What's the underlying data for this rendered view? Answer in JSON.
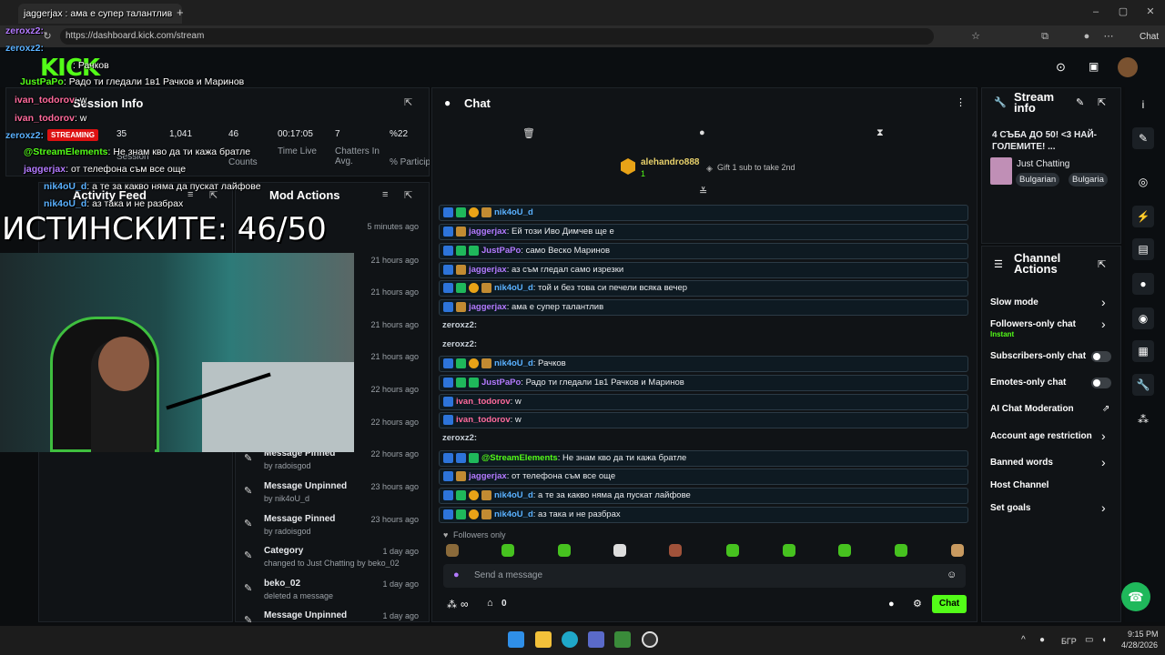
{
  "browser": {
    "tab_title": "jaggerjax : ама е супер талантлив",
    "url": "https://dashboard.kick.com/stream",
    "chat_btn": "Chat",
    "window_controls": [
      "–",
      "▢",
      "✕"
    ]
  },
  "overlay_chat": [
    {
      "user": "zeroxz2:",
      "text": ""
    },
    {
      "user": "zeroxz2:",
      "text": ""
    },
    {
      "user": "",
      "text": ": Рачков"
    },
    {
      "user": "JustPaPo",
      "text": ": Радо ти гледали 1в1 Рачков и Маринов"
    },
    {
      "user": "ivan_todorov",
      "text": ": w"
    },
    {
      "user": "ivan_todorov",
      "text": ": w"
    },
    {
      "user": "zeroxz2:",
      "text": ""
    },
    {
      "user": "@StreamElements",
      "text": ": Не знам кво да ти кажа братле"
    },
    {
      "user": "jaggerjax",
      "text": ": от телефона съм все още"
    },
    {
      "user": "nik4oU_d",
      "text": ": а те за какво няма да пускат лайфове"
    },
    {
      "user": "nik4oU_d",
      "text": ": аз така и не разбрах"
    }
  ],
  "big_overlay": "ИСТИНСКИТЕ: 46/50",
  "session": {
    "title": "Session Info",
    "streaming": "STREAMING",
    "stats": [
      {
        "value": "35",
        "label": "Session"
      },
      {
        "value": "1,041",
        "label": ""
      },
      {
        "value": "46",
        "label": "Counts"
      },
      {
        "value": "00:17:05",
        "label": "Time Live"
      },
      {
        "value": "7",
        "label": "Chatters In Avg."
      },
      {
        "value": "%22",
        "label": "% Participat"
      }
    ]
  },
  "activity": {
    "title": "Activity Feed"
  },
  "mod": {
    "title": "Mod Actions",
    "rows": [
      {
        "title": "",
        "sub": "",
        "time": "5 minutes ago"
      },
      {
        "title": "",
        "sub": "",
        "time": "21 hours ago"
      },
      {
        "title": "",
        "sub": "",
        "time": "21 hours ago"
      },
      {
        "title": "",
        "sub": "",
        "time": "21 hours ago"
      },
      {
        "title": "",
        "sub": "by beko_02",
        "time": "21 hours ago"
      },
      {
        "title": "",
        "sub": "beko_02",
        "time": "22 hours ago"
      },
      {
        "title": "",
        "sub": "",
        "time": "22 hours ago"
      },
      {
        "title": "Message Pinned",
        "sub": "by radoisgod",
        "time": "22 hours ago"
      },
      {
        "title": "Message Unpinned",
        "sub": "by nik4oU_d",
        "time": "23 hours ago"
      },
      {
        "title": "Message Pinned",
        "sub": "by radoisgod",
        "time": "23 hours ago"
      },
      {
        "title": "Category",
        "sub": "changed to Just Chatting by beko_02",
        "time": "1 day ago"
      },
      {
        "title": "beko_02",
        "sub": "deleted a message",
        "time": "1 day ago"
      },
      {
        "title": "Message Unpinned",
        "sub": "",
        "time": "1 day ago"
      }
    ]
  },
  "chat": {
    "title": "Chat",
    "pinned_user": "alehandro888",
    "pinned_count": "1",
    "gift_text": "Gift 1 sub to take 2nd",
    "messages": [
      {
        "user": "nik4oU_d",
        "color": "blue",
        "text": "",
        "badges": [
          "blue",
          "green",
          "gold",
          "gift"
        ]
      },
      {
        "user": "jaggerjax",
        "color": "purple",
        "text": ": Ей този Иво Димчев ще е",
        "badges": [
          "blue",
          "gift"
        ]
      },
      {
        "user": "JustPaPo",
        "color": "purple",
        "text": ": само Веско Маринов",
        "badges": [
          "blue",
          "green",
          "green"
        ]
      },
      {
        "user": "jaggerjax",
        "color": "purple",
        "text": ": аз съм гледал само изрезки",
        "badges": [
          "blue",
          "gift"
        ]
      },
      {
        "user": "nik4oU_d",
        "color": "blue",
        "text": ": той и без това си печели всяка вечер",
        "badges": [
          "blue",
          "green",
          "gold",
          "gift"
        ]
      },
      {
        "user": "jaggerjax",
        "color": "purple",
        "text": ": ама е супер талантлив",
        "badges": [
          "blue",
          "gift"
        ]
      },
      {
        "user": "zeroxz2:",
        "color": "grey",
        "text": "",
        "badges": [],
        "plain": true
      },
      {
        "user": "zeroxz2:",
        "color": "grey",
        "text": "",
        "badges": [],
        "plain": true
      },
      {
        "user": "nik4oU_d",
        "color": "blue",
        "text": ": Рачков",
        "badges": [
          "blue",
          "green",
          "gold",
          "gift"
        ]
      },
      {
        "user": "JustPaPo",
        "color": "purple",
        "text": ": Радо ти гледали 1в1 Рачков и Маринов",
        "badges": [
          "blue",
          "green",
          "green"
        ]
      },
      {
        "user": "ivan_todorov",
        "color": "pink",
        "text": ": w",
        "badges": [
          "blue"
        ]
      },
      {
        "user": "ivan_todorov",
        "color": "pink",
        "text": ": w",
        "badges": [
          "blue"
        ]
      },
      {
        "user": "zeroxz2:",
        "color": "grey",
        "text": "",
        "badges": [],
        "plain": true
      },
      {
        "user": "@StreamElements",
        "color": "green",
        "text": ": Не знам кво да ти кажа братле",
        "badges": [
          "blue",
          "blue",
          "green"
        ]
      },
      {
        "user": "jaggerjax",
        "color": "purple",
        "text": ": от телефона съм все още",
        "badges": [
          "blue",
          "gift"
        ]
      },
      {
        "user": "nik4oU_d",
        "color": "blue",
        "text": ": а те за какво няма да пускат лайфове",
        "badges": [
          "blue",
          "green",
          "gold",
          "gift"
        ]
      },
      {
        "user": "nik4oU_d",
        "color": "blue",
        "text": ": аз така и не разбрах",
        "badges": [
          "blue",
          "green",
          "gold",
          "gift"
        ]
      }
    ],
    "followers_only": "Followers only",
    "placeholder": "Send a message",
    "count": "0",
    "send": "Chat",
    "infinity": "∞"
  },
  "stream_info": {
    "title": "Stream info",
    "stream_title": "4 СЪБА ДО 50! <3 НАЙ-ГОЛЕМИТЕ! ...",
    "category": "Just Chatting",
    "tags": [
      "Bulgarian",
      "Bulgaria"
    ]
  },
  "channel_actions": {
    "title": "Channel Actions",
    "rows": [
      {
        "label": "Slow mode",
        "control": "chevron"
      },
      {
        "label": "Followers-only chat",
        "sub": "Instant",
        "control": "chevron"
      },
      {
        "label": "Subscribers-only chat",
        "control": "toggle"
      },
      {
        "label": "Emotes-only chat",
        "control": "toggle"
      },
      {
        "label": "AI Chat Moderation",
        "control": "external"
      },
      {
        "label": "Account age restriction",
        "control": "chevron"
      },
      {
        "label": "Banned words",
        "control": "chevron"
      },
      {
        "label": "Host Channel",
        "control": "none"
      },
      {
        "label": "Set goals",
        "control": "chevron"
      }
    ]
  },
  "taskbar": {
    "lang": "БГР",
    "time": "9:15 PM",
    "date": "4/28/2026"
  },
  "colors": {
    "brand": "#53fc18",
    "bg": "#0b0d0f",
    "panel": "#101316"
  }
}
